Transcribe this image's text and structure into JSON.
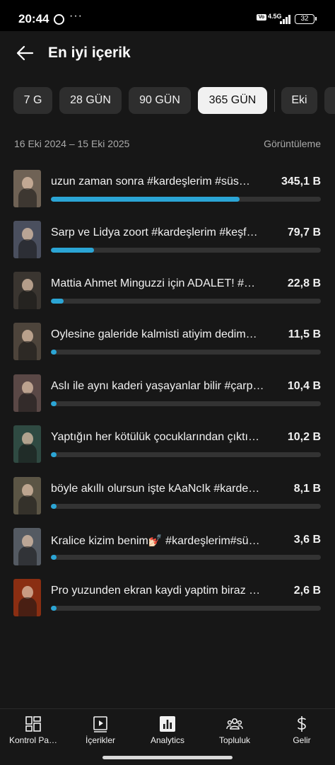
{
  "status_bar": {
    "time": "20:44",
    "network": "4.5G",
    "volte": "VoLTE",
    "battery": "32"
  },
  "header": {
    "title": "En iyi içerik"
  },
  "chips": [
    {
      "label": "7 G",
      "active": false
    },
    {
      "label": "28 GÜN",
      "active": false
    },
    {
      "label": "90 GÜN",
      "active": false
    },
    {
      "label": "365 GÜN",
      "active": true
    },
    {
      "label": "Eki",
      "active": false
    },
    {
      "label": "",
      "active": false
    }
  ],
  "range": {
    "label": "16 Eki 2024 – 15 Eki 2025",
    "metric": "Görüntüleme"
  },
  "items": [
    {
      "title": "uzun zaman sonra #kardeşlerim #süs…",
      "value": "345,1 B",
      "fraction": 0.7,
      "thumb_color": "#6f6255"
    },
    {
      "title": "Sarp ve Lidya zoort #kardeşlerim #keşf…",
      "value": "79,7 B",
      "fraction": 0.16,
      "thumb_color": "#4a4f5e"
    },
    {
      "title": "Mattia Ahmet Minguzzi için ADALET! #…",
      "value": "22,8 B",
      "fraction": 0.046,
      "thumb_color": "#3a3530"
    },
    {
      "title": "Oylesine galeride kalmisti atiyim dedim…",
      "value": "11,5 B",
      "fraction": 0.02,
      "thumb_color": "#4d443b"
    },
    {
      "title": "Aslı ile aynı kaderi yaşayanlar bilir #çarp…",
      "value": "10,4 B",
      "fraction": 0.02,
      "thumb_color": "#5a4846"
    },
    {
      "title": "Yaptığın her kötülük çocuklarından çıktı…",
      "value": "10,2 B",
      "fraction": 0.02,
      "thumb_color": "#2f4a42"
    },
    {
      "title": "böyle akıllı olursun işte kAaNcIk #kardeşl…",
      "value": "8,1 B",
      "fraction": 0.02,
      "thumb_color": "#5b5545"
    },
    {
      "title": "Kralice kizim benim💅🏻 #kardeşlerim#sü…",
      "value": "3,6 B",
      "fraction": 0.02,
      "thumb_color": "#545a62"
    },
    {
      "title": "Pro yuzunden ekran kaydi yaptim biraz k…",
      "value": "2,6 B",
      "fraction": 0.02,
      "thumb_color": "#8a2e12"
    }
  ],
  "bottom_nav": [
    {
      "label": "Kontrol Pa…",
      "icon": "dashboard-icon"
    },
    {
      "label": "İçerikler",
      "icon": "content-icon"
    },
    {
      "label": "Analytics",
      "icon": "analytics-icon"
    },
    {
      "label": "Topluluk",
      "icon": "community-icon"
    },
    {
      "label": "Gelir",
      "icon": "earn-icon"
    }
  ],
  "colors": {
    "accent": "#2ba5d5",
    "background": "#171717",
    "chip_active": "#f1f1f1"
  }
}
